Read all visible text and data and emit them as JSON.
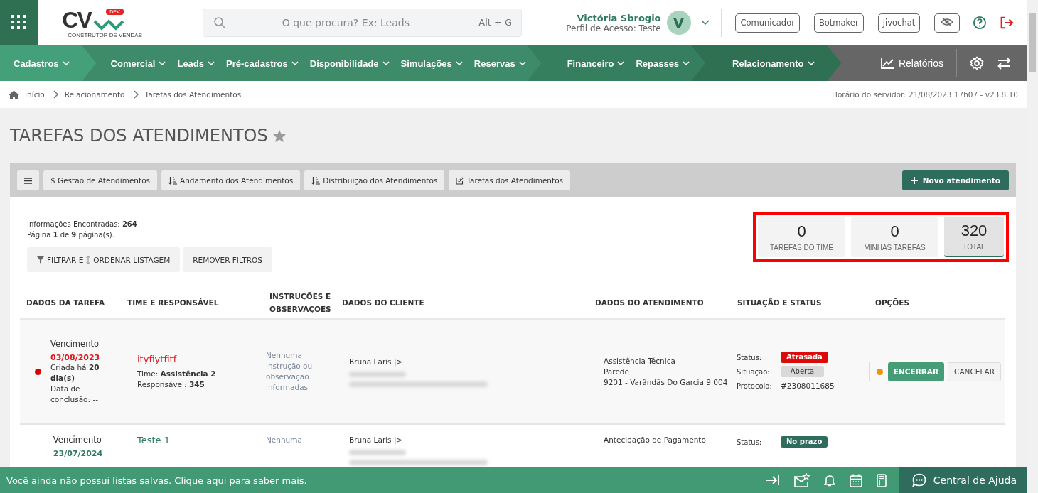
{
  "header": {
    "logo": {
      "mark": "CV",
      "badge": "DEV",
      "tagline": "CONSTRUTOR DE VENDAS"
    },
    "search": {
      "placeholder": "O que procura? Ex: Leads",
      "shortcut": "Alt + G"
    },
    "user": {
      "name": "Victória Sbrogio",
      "profile": "Perfil de Acesso: Teste",
      "initial": "V"
    },
    "buttons": [
      "Comunicador",
      "Botmaker",
      "Jivochat"
    ]
  },
  "nav": {
    "sections": [
      {
        "items": [
          "Cadastros"
        ]
      },
      {
        "items": [
          "Comercial",
          "Leads",
          "Pré-cadastros",
          "Disponibilidade",
          "Simulações",
          "Reservas"
        ]
      },
      {
        "items": [
          "Financeiro",
          "Repasses"
        ]
      },
      {
        "items": [
          "Relacionamento"
        ]
      }
    ],
    "reports": "Relatórios"
  },
  "breadcrumb": [
    "Início",
    "Relacionamento",
    "Tarefas dos Atendimentos"
  ],
  "server_time": "Horário do servidor: 21/08/2023 17h07 - v23.8.10",
  "page": {
    "title": "TAREFAS DOS ATENDIMENTOS",
    "favorite": false
  },
  "toolbar": {
    "tabs": [
      {
        "kind": "menu"
      },
      {
        "kind": "plain",
        "label": "$ Gestão de Atendimentos"
      },
      {
        "kind": "sort",
        "label": "Andamento dos Atendimentos"
      },
      {
        "kind": "sort",
        "label": "Distribuição dos Atendimentos"
      },
      {
        "kind": "edit",
        "label": "Tarefas dos Atendimentos"
      }
    ],
    "new_button": "Novo atendimento"
  },
  "summary": {
    "found": "Informações Encontradas: **264**",
    "pages": "Página **1** de **9** página(s)."
  },
  "filters": {
    "filter_label": "FILTRAR E",
    "order_label": "ORDENAR LISTAGEM",
    "remove": "REMOVER FILTROS"
  },
  "counters": [
    {
      "value": "0",
      "label": "TAREFAS DO TIME",
      "selected": false
    },
    {
      "value": "0",
      "label": "MINHAS TAREFAS",
      "selected": false
    },
    {
      "value": "320",
      "label": "TOTAL",
      "selected": true
    }
  ],
  "table": {
    "columns": [
      "DADOS DA TAREFA",
      "TIME E RESPONSÁVEL",
      "INSTRUÇÕES E OBSERVAÇÕES",
      "DADOS DO CLIENTE",
      "DADOS DO ATENDIMENTO",
      "SITUAÇÃO E STATUS",
      "OPÇÕES"
    ],
    "rows": [
      {
        "due_marker": {
          "color": "#dd0000"
        },
        "due_label": "Vencimento",
        "due_date": "03/08/2023",
        "overdue": true,
        "created": "Criada há **20 dia(s)**",
        "completion": "Data de conclusão: --",
        "title": "ityfiytfitf",
        "team": "Time: **Assistência 2**",
        "owner": "Responsável: **345**",
        "instructions": "Nenhuma instrução ou observação informadas",
        "client": "Bruna Laris |>",
        "attendance": [
          "Assistência Técnica",
          "Parede",
          "9201 - Varândãs Do Garcia 9 004"
        ],
        "status": [
          {
            "label": "Status:",
            "value": "Atrasada",
            "kind": "late"
          },
          {
            "label": "Situação:",
            "value": "Aberta",
            "kind": "neutral"
          },
          {
            "label": "Protocolo:",
            "value": "#2308011685",
            "kind": "text"
          }
        ],
        "options_marker": {
          "color": "#f39200"
        },
        "actions": {
          "close": "ENCERRAR",
          "cancel": "CANCELAR"
        }
      },
      {
        "due_label": "Vencimento",
        "due_date": "23/07/2024",
        "overdue": false,
        "title": "Teste 1",
        "instructions": "Nenhuma",
        "client": "Bruna Laris |>",
        "attendance": [
          "Antecipação de Pagamento"
        ],
        "status": [
          {
            "label": "Status:",
            "value": "No prazo",
            "kind": "ontime"
          }
        ]
      }
    ]
  },
  "bottom_bar": {
    "message": "Você ainda não possui listas salvas. Clique aqui para saber mais.",
    "help": "Central de Ajuda"
  }
}
